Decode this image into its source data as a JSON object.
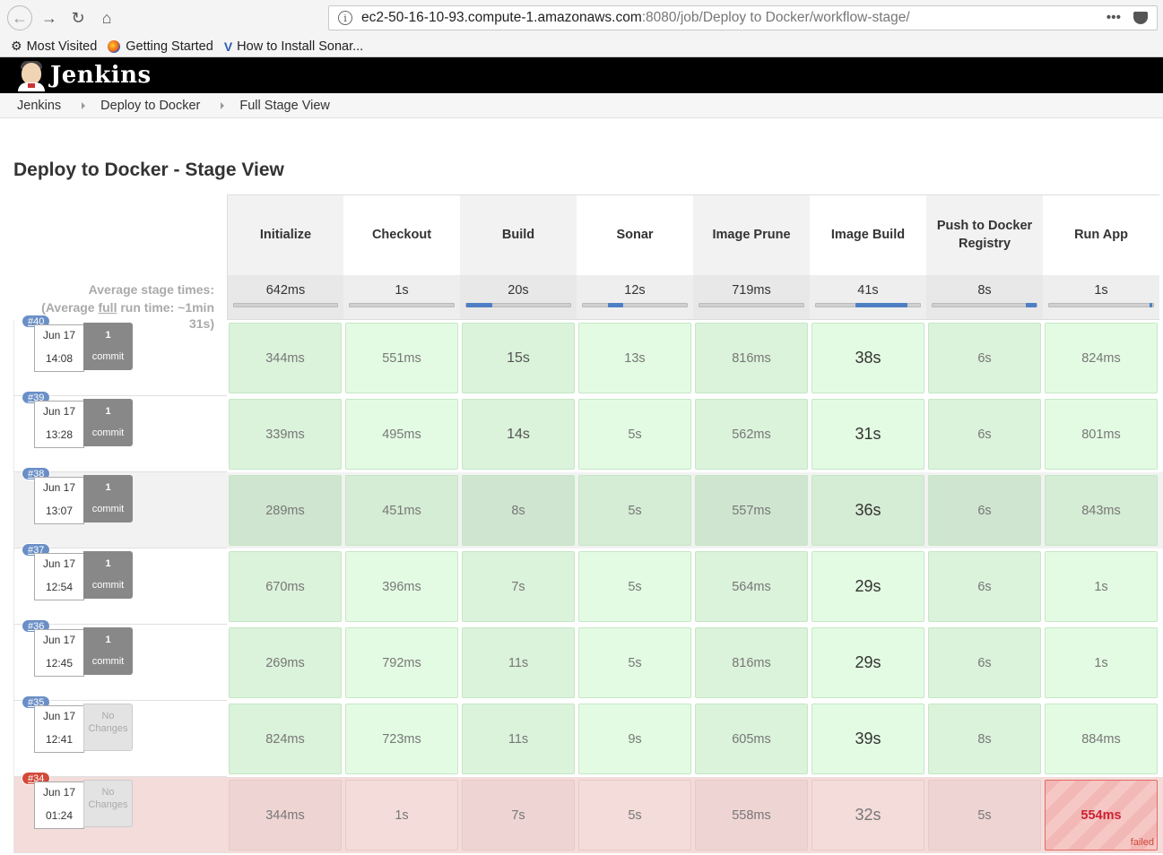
{
  "browser": {
    "url_host": "ec2-50-16-10-93.compute-1.amazonaws.com",
    "url_path": ":8080/job/Deploy to Docker/workflow-stage/",
    "bookmarks": [
      "Most Visited",
      "Getting Started",
      "How to Install Sonar..."
    ]
  },
  "app": {
    "title": "Jenkins"
  },
  "breadcrumb": [
    "Jenkins",
    "Deploy to Docker",
    "Full Stage View"
  ],
  "page_title": "Deploy to Docker - Stage View",
  "avg_label_line1": "Average stage times:",
  "avg_label_line2a": "(Average ",
  "avg_label_full": "full",
  "avg_label_line2b": " run time: ~1min",
  "avg_label_line3": "31s)",
  "stages": [
    "Initialize",
    "Checkout",
    "Build",
    "Sonar",
    "Image Prune",
    "Image Build",
    "Push to Docker Registry",
    "Run App"
  ],
  "avg_times": [
    "642ms",
    "1s",
    "20s",
    "12s",
    "719ms",
    "41s",
    "8s",
    "1s"
  ],
  "avg_bar_fraction": [
    0.05,
    0.08,
    0.25,
    0.15,
    0.06,
    0.5,
    0.1,
    0.02
  ],
  "builds": [
    {
      "id": "#40",
      "date": "Jun 17",
      "time": "14:08",
      "commit_count": "1",
      "commit_label": "commit",
      "times": [
        "344ms",
        "551ms",
        "15s",
        "13s",
        "816ms",
        "38s",
        "6s",
        "824ms"
      ]
    },
    {
      "id": "#39",
      "date": "Jun 17",
      "time": "13:28",
      "commit_count": "1",
      "commit_label": "commit",
      "times": [
        "339ms",
        "495ms",
        "14s",
        "5s",
        "562ms",
        "31s",
        "6s",
        "801ms"
      ]
    },
    {
      "id": "#38",
      "date": "Jun 17",
      "time": "13:07",
      "commit_count": "1",
      "commit_label": "commit",
      "times": [
        "289ms",
        "451ms",
        "8s",
        "5s",
        "557ms",
        "36s",
        "6s",
        "843ms"
      ]
    },
    {
      "id": "#37",
      "date": "Jun 17",
      "time": "12:54",
      "commit_count": "1",
      "commit_label": "commit",
      "times": [
        "670ms",
        "396ms",
        "7s",
        "5s",
        "564ms",
        "29s",
        "6s",
        "1s"
      ]
    },
    {
      "id": "#36",
      "date": "Jun 17",
      "time": "12:45",
      "commit_count": "1",
      "commit_label": "commit",
      "times": [
        "269ms",
        "792ms",
        "11s",
        "5s",
        "816ms",
        "29s",
        "6s",
        "1s"
      ]
    },
    {
      "id": "#35",
      "date": "Jun 17",
      "time": "12:41",
      "commit_count": "No",
      "commit_label": "Changes",
      "times": [
        "824ms",
        "723ms",
        "11s",
        "9s",
        "605ms",
        "39s",
        "8s",
        "884ms"
      ]
    },
    {
      "id": "#34",
      "date": "Jun 17",
      "time": "01:24",
      "commit_count": "No",
      "commit_label": "Changes",
      "times": [
        "344ms",
        "1s",
        "7s",
        "5s",
        "558ms",
        "32s",
        "5s",
        "554ms"
      ],
      "failed_stage_label": "failed"
    }
  ]
}
